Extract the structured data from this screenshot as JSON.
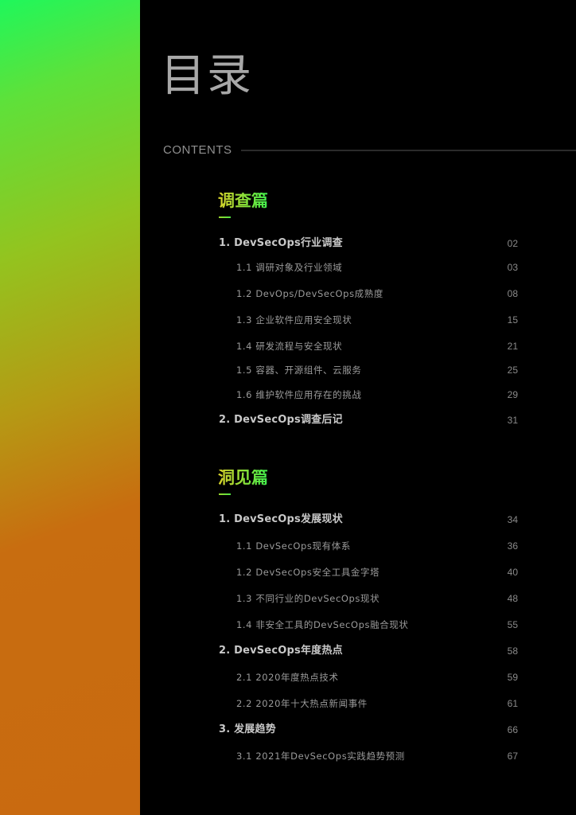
{
  "title": "目录",
  "contents_label": "CONTENTS",
  "sections": [
    {
      "title": "调查篇",
      "entries": [
        {
          "label": "1. DevSecOps行业调查",
          "page": "02",
          "level": 1
        },
        {
          "label": "1.1 调研对象及行业领域",
          "page": "03",
          "level": 2
        },
        {
          "label": "1.2 DevOps/DevSecOps成熟度",
          "page": "08",
          "level": 2
        },
        {
          "label": "1.3 企业软件应用安全现状",
          "page": "15",
          "level": 2
        },
        {
          "label": "1.4 研发流程与安全现状",
          "page": "21",
          "level": 2
        },
        {
          "label": "1.5 容器、开源组件、云服务",
          "page": "25",
          "level": 2
        },
        {
          "label": "1.6 维护软件应用存在的挑战",
          "page": "29",
          "level": 2
        },
        {
          "label": "2. DevSecOps调查后记",
          "page": "31",
          "level": 1
        }
      ]
    },
    {
      "title": "洞见篇",
      "entries": [
        {
          "label": "1. DevSecOps发展现状",
          "page": "34",
          "level": 1
        },
        {
          "label": "1.1 DevSecOps现有体系",
          "page": "36",
          "level": 2
        },
        {
          "label": "1.2 DevSecOps安全工具金字塔",
          "page": "40",
          "level": 2
        },
        {
          "label": "1.3 不同行业的DevSecOps现状",
          "page": "48",
          "level": 2
        },
        {
          "label": "1.4 非安全工具的DevSecOps融合现状",
          "page": "55",
          "level": 2
        },
        {
          "label": "2. DevSecOps年度热点",
          "page": "58",
          "level": 1
        },
        {
          "label": "2.1 2020年度热点技术",
          "page": "59",
          "level": 2
        },
        {
          "label": "2.2 2020年十大热点新闻事件",
          "page": "61",
          "level": 2
        },
        {
          "label": "3. 发展趋势",
          "page": "66",
          "level": 1
        },
        {
          "label": "3.1 2021年DevSecOps实践趋势预测",
          "page": "67",
          "level": 2
        }
      ]
    }
  ]
}
